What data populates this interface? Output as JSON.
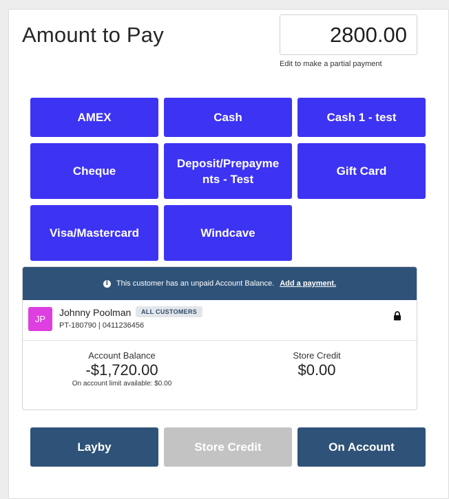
{
  "payment": {
    "title": "Amount to Pay",
    "amount": "2800.00",
    "hint": "Edit to make a partial payment"
  },
  "methods": [
    "AMEX",
    "Cash",
    "Cash 1 - test",
    "Cheque",
    "Deposit/Prepayments - Test",
    "Gift Card",
    "Visa/Mastercard",
    "Windcave"
  ],
  "customer": {
    "alert_text": "This customer has an unpaid Account Balance.",
    "alert_link": "Add a payment.",
    "initials": "JP",
    "name": "Johnny Poolman",
    "tag": "ALL CUSTOMERS",
    "sub": "PT-180790 | 0411236456",
    "account_balance_label": "Account Balance",
    "account_balance": "-$1,720.00",
    "account_limit_note": "On account limit available: $0.00",
    "store_credit_label": "Store Credit",
    "store_credit": "$0.00"
  },
  "actions": {
    "layby": "Layby",
    "store_credit": "Store Credit",
    "on_account": "On Account"
  },
  "colors": {
    "method_button": "#3d33f3",
    "dark_button": "#2f5378",
    "disabled_button": "#c3c3c3",
    "avatar": "#de3fe0"
  }
}
